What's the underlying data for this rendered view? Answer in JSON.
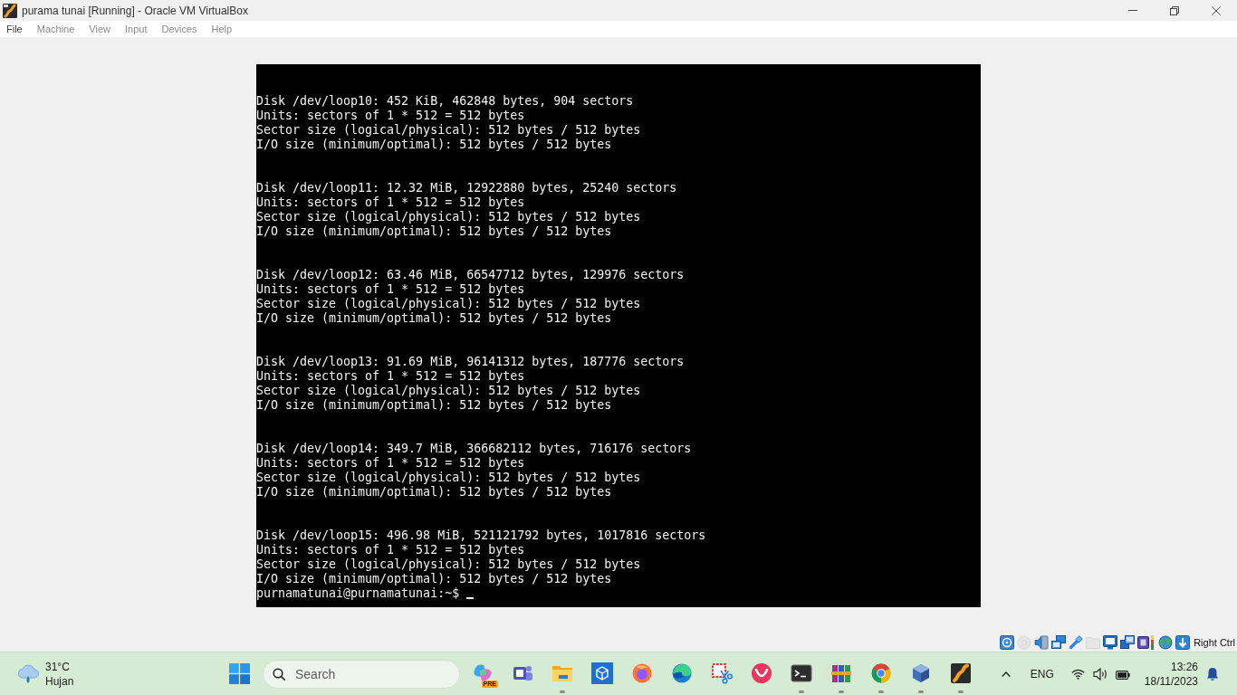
{
  "window": {
    "title": "purama tunai [Running] - Oracle VM VirtualBox"
  },
  "menu": [
    {
      "label": "File",
      "active": true
    },
    {
      "label": "Machine",
      "active": false
    },
    {
      "label": "View",
      "active": false
    },
    {
      "label": "Input",
      "active": false
    },
    {
      "label": "Devices",
      "active": false
    },
    {
      "label": "Help",
      "active": false
    }
  ],
  "terminal": {
    "blocks": [
      {
        "lines": [
          "Disk /dev/loop10: 452 KiB, 462848 bytes, 904 sectors",
          "Units: sectors of 1 * 512 = 512 bytes",
          "Sector size (logical/physical): 512 bytes / 512 bytes",
          "I/O size (minimum/optimal): 512 bytes / 512 bytes"
        ]
      },
      {
        "lines": [
          "Disk /dev/loop11: 12.32 MiB, 12922880 bytes, 25240 sectors",
          "Units: sectors of 1 * 512 = 512 bytes",
          "Sector size (logical/physical): 512 bytes / 512 bytes",
          "I/O size (minimum/optimal): 512 bytes / 512 bytes"
        ]
      },
      {
        "lines": [
          "Disk /dev/loop12: 63.46 MiB, 66547712 bytes, 129976 sectors",
          "Units: sectors of 1 * 512 = 512 bytes",
          "Sector size (logical/physical): 512 bytes / 512 bytes",
          "I/O size (minimum/optimal): 512 bytes / 512 bytes"
        ]
      },
      {
        "lines": [
          "Disk /dev/loop13: 91.69 MiB, 96141312 bytes, 187776 sectors",
          "Units: sectors of 1 * 512 = 512 bytes",
          "Sector size (logical/physical): 512 bytes / 512 bytes",
          "I/O size (minimum/optimal): 512 bytes / 512 bytes"
        ]
      },
      {
        "lines": [
          "Disk /dev/loop14: 349.7 MiB, 366682112 bytes, 716176 sectors",
          "Units: sectors of 1 * 512 = 512 bytes",
          "Sector size (logical/physical): 512 bytes / 512 bytes",
          "I/O size (minimum/optimal): 512 bytes / 512 bytes"
        ]
      },
      {
        "lines": [
          "Disk /dev/loop15: 496.98 MiB, 521121792 bytes, 1017816 sectors",
          "Units: sectors of 1 * 512 = 512 bytes",
          "Sector size (logical/physical): 512 bytes / 512 bytes",
          "I/O size (minimum/optimal): 512 bytes / 512 bytes"
        ]
      }
    ],
    "prompt": "purnamatunai@purnamatunai:~$"
  },
  "status_bar": {
    "indicators": [
      {
        "disabled": false
      },
      {
        "disabled": true
      },
      {
        "disabled": false
      },
      {
        "disabled": false
      },
      {
        "disabled": false
      },
      {
        "disabled": true
      },
      {
        "disabled": false
      },
      {
        "disabled": false
      },
      {
        "disabled": false
      },
      {
        "disabled": false
      },
      {
        "disabled": false
      }
    ],
    "host_key": "Right Ctrl"
  },
  "taskbar": {
    "weather": {
      "temperature": "31°C",
      "condition": "Hujan"
    },
    "search": {
      "placeholder": "Search"
    },
    "apps": [
      {
        "running": false,
        "badge": "PRE"
      },
      {
        "running": false
      },
      {
        "running": true
      },
      {
        "running": false
      },
      {
        "running": false
      },
      {
        "running": false
      },
      {
        "running": false
      },
      {
        "running": false
      },
      {
        "running": true
      },
      {
        "running": true
      },
      {
        "running": true
      },
      {
        "running": true
      },
      {
        "running": true
      }
    ],
    "tray": {
      "language": "ENG",
      "time": "13:26",
      "date": "18/11/2023"
    }
  }
}
